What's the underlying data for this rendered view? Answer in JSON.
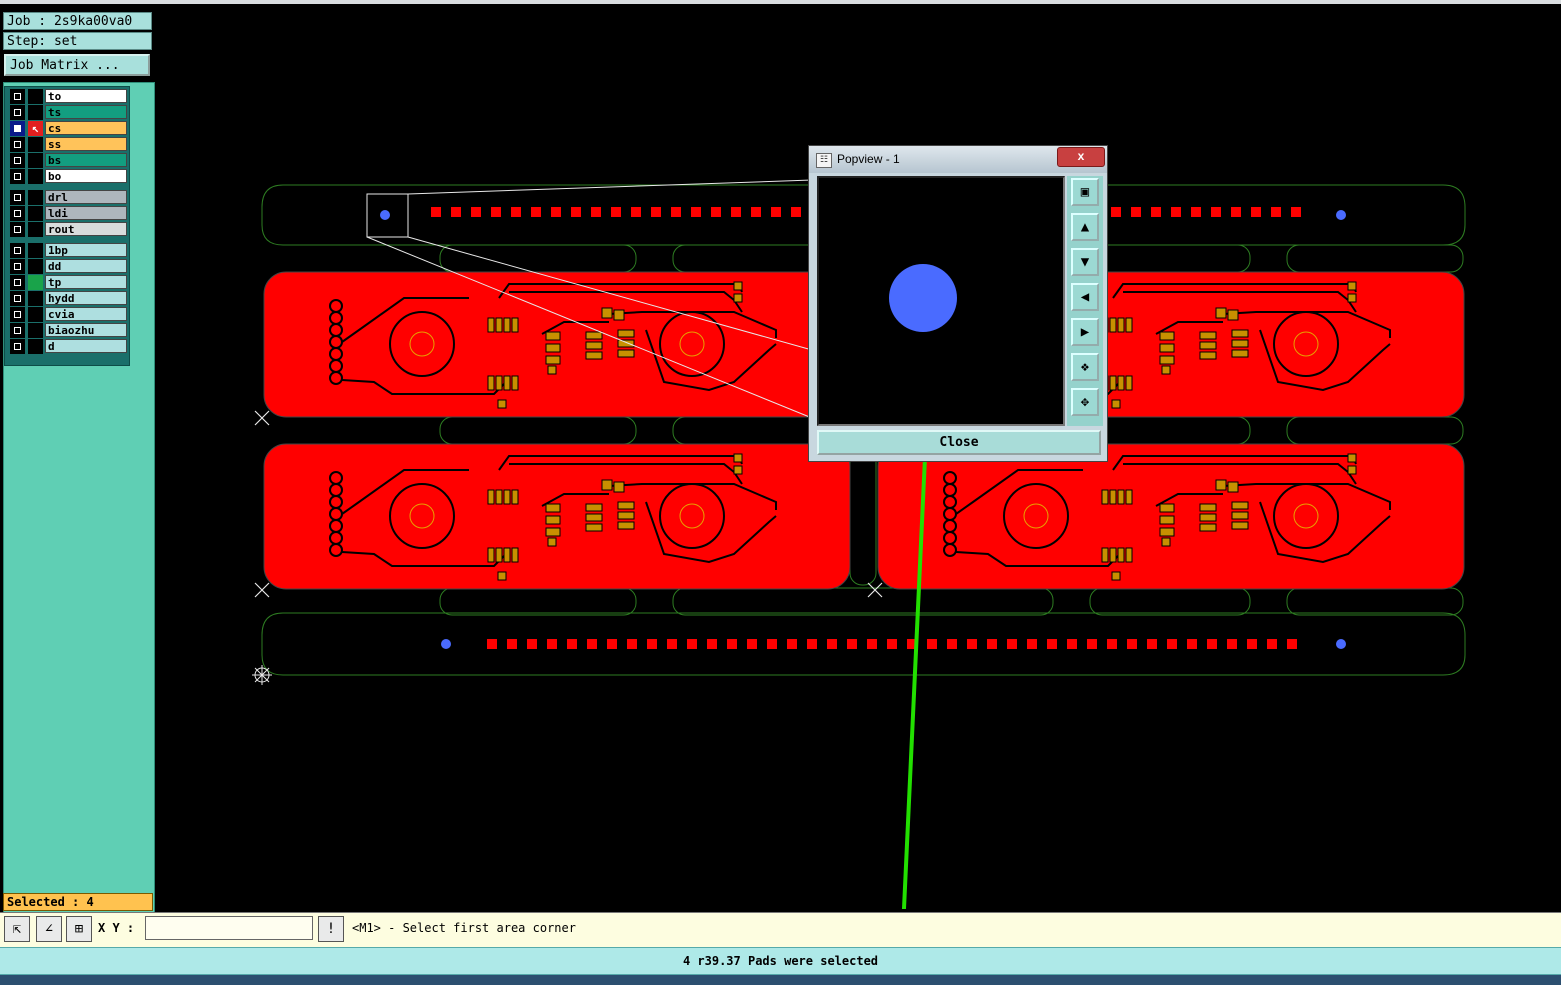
{
  "job_label": "Job : 2s9ka00va0",
  "step_label": "Step: set",
  "job_matrix_button": "Job Matrix ...",
  "layers": [
    {
      "name": "to",
      "color": "#ffffff"
    },
    {
      "name": "ts",
      "color": "#139e80"
    },
    {
      "name": "cs",
      "color": "#ffc35a"
    },
    {
      "name": "ss",
      "color": "#ffc35a"
    },
    {
      "name": "bs",
      "color": "#139e80"
    },
    {
      "name": "bo",
      "color": "#ffffff"
    },
    {
      "name": "drl",
      "color": "#aeb6bd"
    },
    {
      "name": "ldi",
      "color": "#aeb6bd"
    },
    {
      "name": "rout",
      "color": "#d8dcdc"
    },
    {
      "name": "1bp",
      "color": "#aedfe0"
    },
    {
      "name": "dd",
      "color": "#aedfe0"
    },
    {
      "name": "tp",
      "color": "#aedfe0"
    },
    {
      "name": "hydd",
      "color": "#aedfe0"
    },
    {
      "name": "cvia",
      "color": "#aedfe0"
    },
    {
      "name": "biaozhu",
      "color": "#aedfe0"
    },
    {
      "name": "d",
      "color": "#aedfe0"
    }
  ],
  "selected_label": "Selected : 4",
  "xy_label": "X Y :",
  "xy_value": "",
  "prompt_text": "<M1> - Select first area corner",
  "status_text": "4 r39.37 Pads were selected",
  "popview": {
    "title": "Popview - 1",
    "close_label": "Close",
    "window_close": "x"
  },
  "colors": {
    "board_copper": "#ff0000",
    "pad_blue": "#4a6bff",
    "outline_green": "#2e7d22",
    "pad_gold": "#c89000",
    "arrow_green": "#22e000"
  }
}
